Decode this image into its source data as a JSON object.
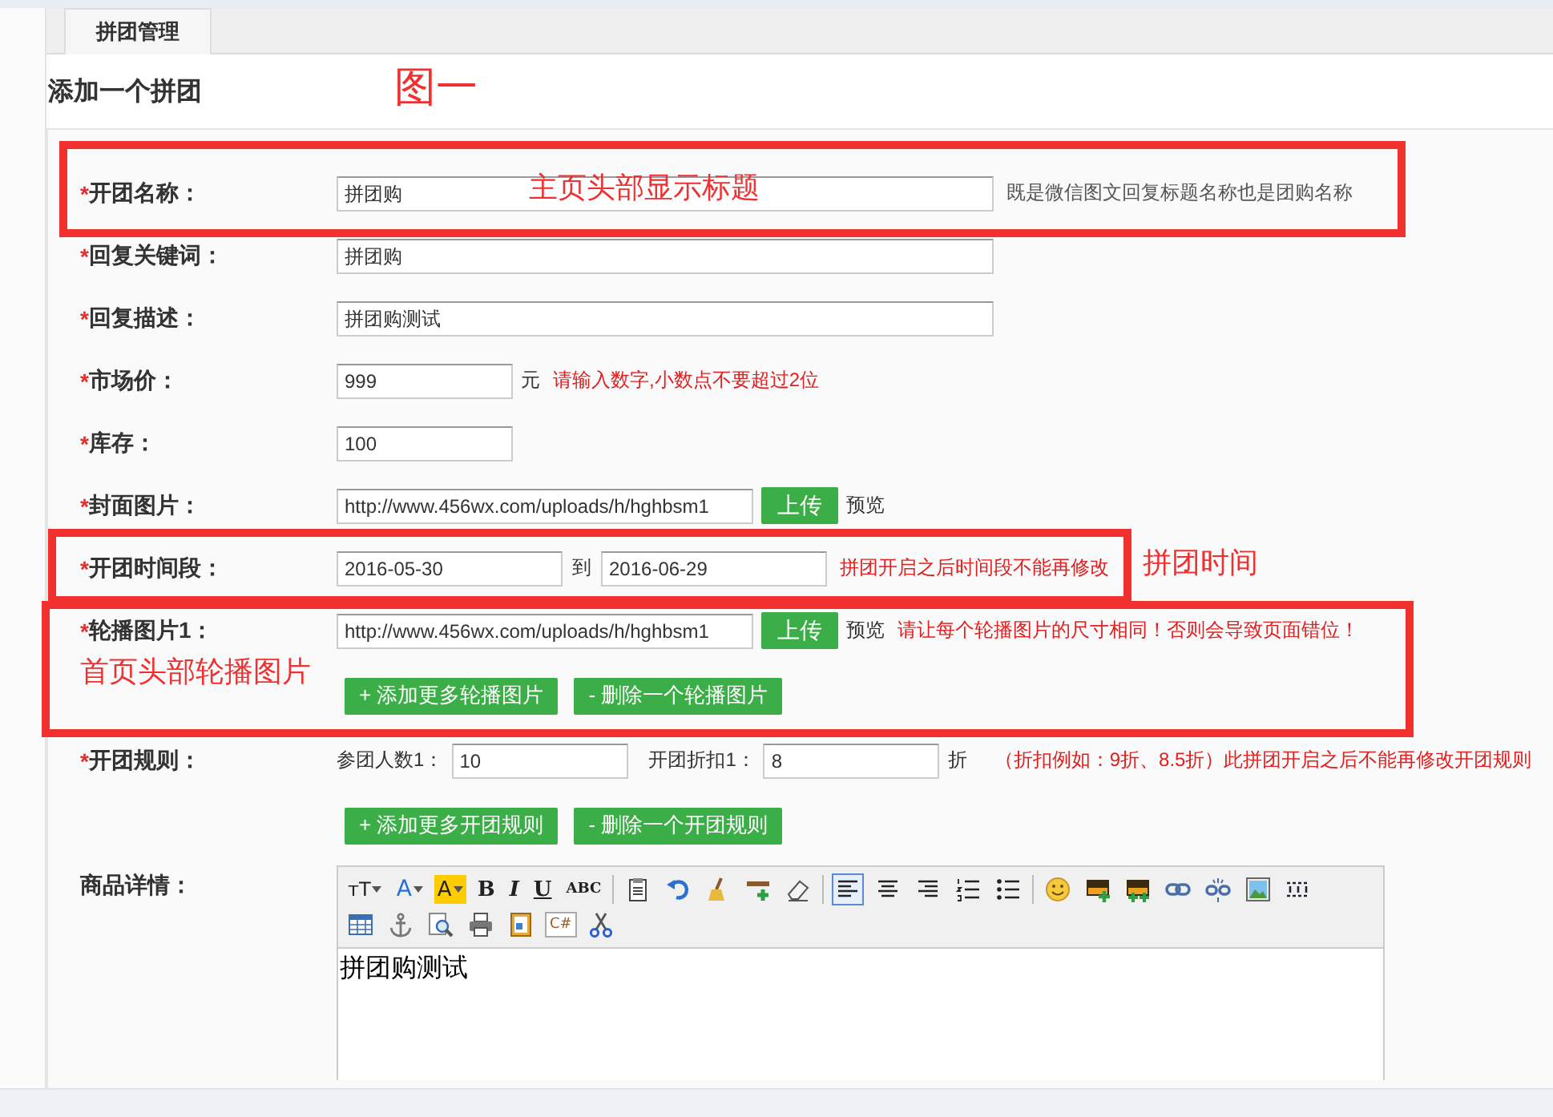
{
  "tabs": [
    {
      "label": "拼团管理",
      "selected": true
    }
  ],
  "page_title": "添加一个拼团",
  "form": {
    "rows": [
      {
        "kind": "long",
        "mark": "*",
        "label": "开团名称：",
        "value": "拼团购",
        "hint": {
          "text": "既是微信图文回复标题名称也是团购名称",
          "color": "#555555"
        }
      },
      {
        "kind": "long",
        "mark": "*",
        "label": "回复关键词：",
        "value": "拼团购"
      },
      {
        "kind": "long",
        "mark": "*",
        "label": "回复描述：",
        "value": "拼团购测试"
      },
      {
        "kind": "short",
        "mark": "*",
        "label": "市场价：",
        "value": "999",
        "unit": "元",
        "hint": {
          "text": "请输入数字,小数点不要超过2位",
          "color": "#e02020"
        }
      },
      {
        "kind": "short",
        "mark": "*",
        "label": "库存：",
        "value": "100"
      },
      {
        "kind": "upload",
        "mark": "*",
        "label": "封面图片：",
        "value": "http://www.456wx.com/uploads/h/hghbsm1",
        "button": "上传",
        "preview": "预览"
      },
      {
        "kind": "daterange",
        "mark": "*",
        "label": "开团时间段：",
        "start": "2016-05-30",
        "separator": "到",
        "end": "2016-06-29",
        "hint": {
          "text": "拼团开启之后时间段不能再修改",
          "color": "#e02020"
        }
      },
      {
        "kind": "upload",
        "mark": "*",
        "label": "轮播图片1：",
        "value": "http://www.456wx.com/uploads/h/hghbsm1",
        "button": "上传",
        "preview": "预览",
        "hint": {
          "text": "请让每个轮播图片的尺寸相同！否则会导致页面错位！",
          "color": "#e02020"
        },
        "actions": [
          "+ 添加更多轮播图片",
          "- 删除一个轮播图片"
        ]
      },
      {
        "kind": "rule",
        "mark": "*",
        "label": "开团规则：",
        "fields": [
          {
            "label": "参团人数1：",
            "value": "10"
          },
          {
            "label": "开团折扣1：",
            "value": "8"
          }
        ],
        "unit": "折",
        "hint": {
          "text": "（折扣例如：9折、8.5折）此拼团开启之后不能再修改开团规则",
          "color": "#e02020"
        },
        "actions": [
          "+ 添加更多开团规则",
          "- 删除一个开团规则"
        ]
      },
      {
        "kind": "editor",
        "label": "商品详情：",
        "content": "拼团购测试"
      }
    ]
  },
  "editor_toolbar": [
    [
      {
        "kind": "fontsize",
        "label": "тT"
      },
      {
        "kind": "fontcolor",
        "label": "A"
      },
      {
        "kind": "highlight",
        "label": "A"
      },
      {
        "kind": "bold",
        "label": "B"
      },
      {
        "kind": "italic",
        "label": "I"
      },
      {
        "kind": "underline",
        "label": "U"
      },
      {
        "kind": "strike",
        "label": "ABC"
      },
      {
        "kind": "separator"
      },
      {
        "kind": "icon"
      },
      {
        "kind": "icon"
      },
      {
        "kind": "icon"
      },
      {
        "kind": "icon"
      },
      {
        "kind": "icon"
      },
      {
        "kind": "separator"
      },
      {
        "kind": "align",
        "selected": true
      },
      {
        "kind": "align",
        "selected": false
      },
      {
        "kind": "align",
        "selected": false
      },
      {
        "kind": "icon"
      },
      {
        "kind": "icon"
      },
      {
        "kind": "separator"
      },
      {
        "kind": "icon"
      },
      {
        "kind": "icon"
      },
      {
        "kind": "icon"
      },
      {
        "kind": "icon"
      },
      {
        "kind": "icon"
      },
      {
        "kind": "icon"
      },
      {
        "kind": "icon"
      }
    ],
    [
      {
        "kind": "icon"
      },
      {
        "kind": "icon"
      },
      {
        "kind": "icon"
      },
      {
        "kind": "icon"
      },
      {
        "kind": "icon"
      },
      {
        "kind": "code",
        "label": "C#"
      },
      {
        "kind": "icon"
      }
    ]
  ],
  "annotations": [
    {
      "kind": "label",
      "text": "图一"
    },
    {
      "kind": "frame"
    },
    {
      "kind": "label",
      "text": "主页头部显示标题"
    },
    {
      "kind": "frame"
    },
    {
      "kind": "label",
      "text": "拼团时间"
    },
    {
      "kind": "frame"
    },
    {
      "kind": "label",
      "text": "首页头部轮播图片"
    }
  ]
}
